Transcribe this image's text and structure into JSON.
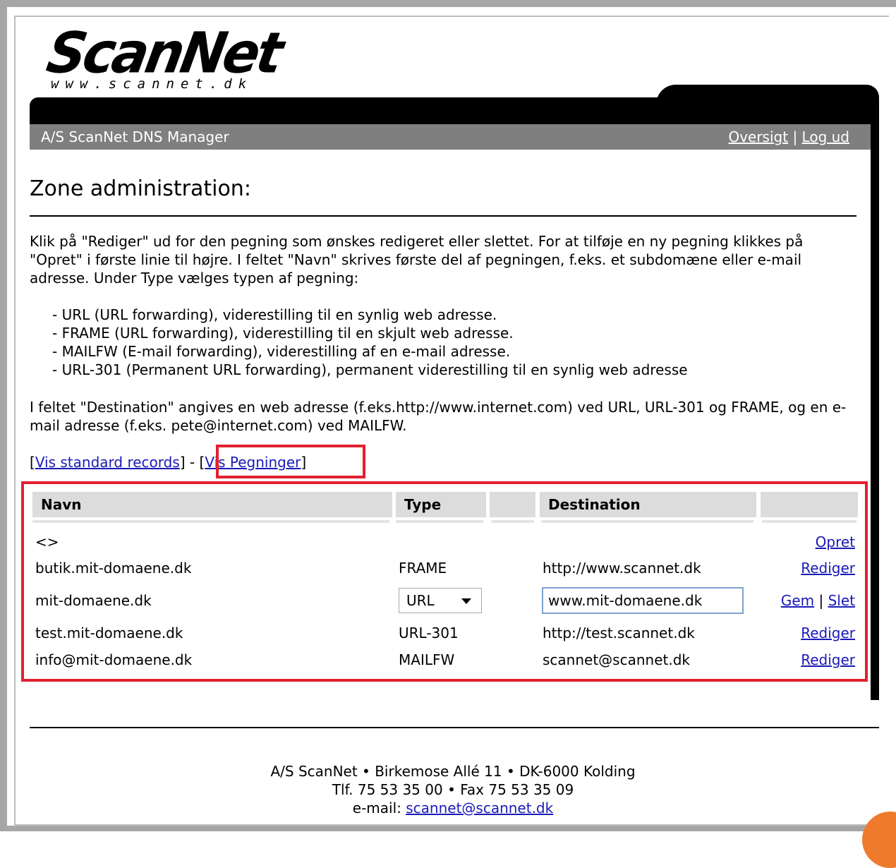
{
  "logo": {
    "name": "ScanNet",
    "url_text": "www.scannet.dk"
  },
  "header": {
    "title": "A/S ScanNet DNS Manager",
    "links": {
      "overview": "Oversigt",
      "separator": "|",
      "logout": "Log ud"
    }
  },
  "page": {
    "title": "Zone administration:",
    "intro": "Klik på \"Rediger\" ud for den pegning som ønskes redigeret eller slettet. For at tilføje en ny pegning klikkes på \"Opret\" i første linie til højre. I feltet \"Navn\" skrives første del af pegningen, f.eks. et subdomæne eller e-mail adresse. Under Type vælges typen af pegning:",
    "bullets": [
      "- URL (URL forwarding), viderestilling til en synlig web adresse.",
      "- FRAME (URL forwarding), viderestilling til en skjult web adresse.",
      "- MAILFW (E-mail forwarding), viderestilling af en e-mail adresse.",
      "- URL-301 (Permanent URL forwarding), permanent viderestilling til en synlig web adresse"
    ],
    "destination_text": "I feltet \"Destination\" angives en web adresse (f.eks.http://www.internet.com) ved URL, URL-301 og FRAME, og en e-mail adresse (f.eks. pete@internet.com) ved MAILFW.",
    "view_links": {
      "standard_open": "[",
      "standard": "Vis standard records",
      "standard_close": "]",
      "sep": " - ",
      "pegninger_open": "[",
      "pegninger": "Vis Pegninger",
      "pegninger_close": "]"
    }
  },
  "table": {
    "headers": {
      "name": "Navn",
      "type": "Type",
      "blank": "",
      "destination": "Destination",
      "actions": ""
    },
    "new_row": {
      "name": "<>",
      "action": "Opret"
    },
    "rows": [
      {
        "name": "butik.mit-domaene.dk",
        "type": "FRAME",
        "destination": "http://www.scannet.dk",
        "action": "Rediger"
      },
      {
        "name": "mit-domaene.dk",
        "type": "URL",
        "destination": "www.mit-domaene.dk",
        "action_save": "Gem",
        "action_sep": "|",
        "action_delete": "Slet"
      },
      {
        "name": "test.mit-domaene.dk",
        "type": "URL-301",
        "destination": "http://test.scannet.dk",
        "action": "Rediger"
      },
      {
        "name": "info@mit-domaene.dk",
        "type": "MAILFW",
        "destination": "scannet@scannet.dk",
        "action": "Rediger"
      }
    ]
  },
  "footer": {
    "line1": "A/S ScanNet • Birkemose Allé 11 • DK-6000 Kolding",
    "line2": "Tlf. 75 53 35 00 • Fax 75 53 35 09",
    "email_label": "e-mail: ",
    "email": "scannet@scannet.dk"
  },
  "colors": {
    "highlight": "#e2212f",
    "link": "#1a1ab8",
    "header_gray": "#7f7f7f",
    "badge": "#ee7a2c"
  }
}
